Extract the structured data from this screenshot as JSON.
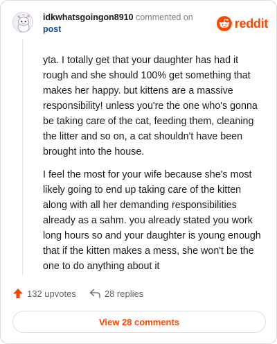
{
  "comment": {
    "username": "idkwhatsgoingon8910",
    "action_text": "commented on",
    "post_link_text": "post",
    "paragraphs": [
      "yta. I totally get that your daughter has had it rough and she should 100% get something that makes her happy. but kittens are a massive responsibility! unless you're the one who's gonna be taking care of the cat, feeding them, cleaning the litter and so on, a cat shouldn't have been brought into the house.",
      "I feel the most for your wife because she's most likely going to end up taking care of the kitten along with all her demanding responsibilities already as a sahm. you already stated you work long hours so and your daughter is young enough that if the kitten makes a mess, she won't be the one to do anything about it"
    ]
  },
  "brand": {
    "name": "reddit",
    "color": "#ff4500"
  },
  "stats": {
    "upvotes": "132 upvotes",
    "replies": "28 replies"
  },
  "footer": {
    "view_comments_label": "View 28 comments"
  },
  "colors": {
    "accent": "#ff4500",
    "link": "#0f4f9e",
    "muted": "#7c7c7c"
  },
  "icons": {
    "avatar": "snoo-avatar",
    "brand": "reddit-logo-icon",
    "upvote": "upvote-arrow-icon",
    "reply": "reply-arrow-icon"
  }
}
